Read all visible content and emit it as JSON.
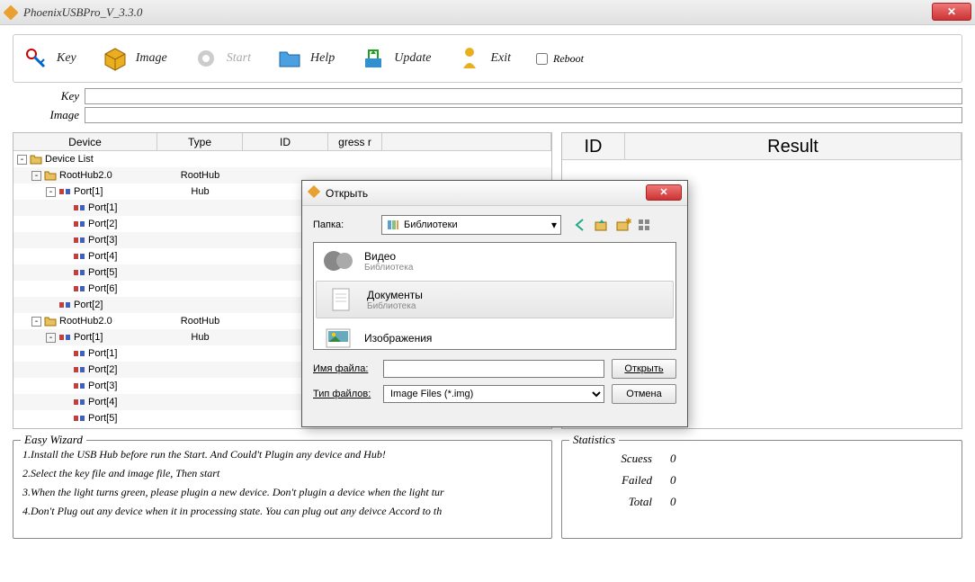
{
  "window": {
    "title": "PhoenixUSBPro_V_3.3.0"
  },
  "toolbar": {
    "key": "Key",
    "image": "Image",
    "start": "Start",
    "help": "Help",
    "update": "Update",
    "exit": "Exit",
    "reboot": "Reboot"
  },
  "fields": {
    "key_label": "Key",
    "key_value": "",
    "image_label": "Image",
    "image_value": ""
  },
  "devgrid": {
    "headers": {
      "device": "Device",
      "type": "Type",
      "id": "ID",
      "progress": "gress r"
    },
    "rows": [
      {
        "indent": 0,
        "exp": "-",
        "icon": "folder",
        "label": "Device List",
        "type": ""
      },
      {
        "indent": 1,
        "exp": "-",
        "icon": "folder",
        "label": "RootHub2.0",
        "type": "RootHub"
      },
      {
        "indent": 2,
        "exp": "-",
        "icon": "port",
        "label": "Port[1]",
        "type": "Hub"
      },
      {
        "indent": 3,
        "exp": "",
        "icon": "port",
        "label": "Port[1]",
        "type": ""
      },
      {
        "indent": 3,
        "exp": "",
        "icon": "port",
        "label": "Port[2]",
        "type": ""
      },
      {
        "indent": 3,
        "exp": "",
        "icon": "port",
        "label": "Port[3]",
        "type": ""
      },
      {
        "indent": 3,
        "exp": "",
        "icon": "port",
        "label": "Port[4]",
        "type": ""
      },
      {
        "indent": 3,
        "exp": "",
        "icon": "port",
        "label": "Port[5]",
        "type": ""
      },
      {
        "indent": 3,
        "exp": "",
        "icon": "port",
        "label": "Port[6]",
        "type": ""
      },
      {
        "indent": 2,
        "exp": "",
        "icon": "port",
        "label": "Port[2]",
        "type": ""
      },
      {
        "indent": 1,
        "exp": "-",
        "icon": "folder",
        "label": "RootHub2.0",
        "type": "RootHub"
      },
      {
        "indent": 2,
        "exp": "-",
        "icon": "port",
        "label": "Port[1]",
        "type": "Hub"
      },
      {
        "indent": 3,
        "exp": "",
        "icon": "port",
        "label": "Port[1]",
        "type": ""
      },
      {
        "indent": 3,
        "exp": "",
        "icon": "port",
        "label": "Port[2]",
        "type": ""
      },
      {
        "indent": 3,
        "exp": "",
        "icon": "port",
        "label": "Port[3]",
        "type": ""
      },
      {
        "indent": 3,
        "exp": "",
        "icon": "port",
        "label": "Port[4]",
        "type": ""
      },
      {
        "indent": 3,
        "exp": "",
        "icon": "port",
        "label": "Port[5]",
        "type": ""
      }
    ]
  },
  "result": {
    "id_header": "ID",
    "result_header": "Result"
  },
  "wizard": {
    "legend": "Easy Wizard",
    "lines": [
      "1.Install the USB Hub before run the Start. And Could't Plugin any device and Hub!",
      "2.Select the key file and image file, Then start",
      "3.When the light turns green, please plugin a new device. Don't plugin a device when the light tur",
      "4.Don't Plug out any device when it in processing state. You can plug out any deivce Accord to th"
    ]
  },
  "stats": {
    "legend": "Statistics",
    "rows": [
      {
        "label": "Scuess",
        "value": "0"
      },
      {
        "label": "Failed",
        "value": "0"
      },
      {
        "label": "Total",
        "value": "0"
      }
    ]
  },
  "dialog": {
    "title": "Открыть",
    "folder_label": "Папка:",
    "folder_value": "Библиотеки",
    "items": [
      {
        "name": "Видео",
        "sub": "Библиотека",
        "icon": "video",
        "selected": false
      },
      {
        "name": "Документы",
        "sub": "Библиотека",
        "icon": "doc",
        "selected": true
      },
      {
        "name": "Изображения",
        "sub": "",
        "icon": "image",
        "selected": false
      }
    ],
    "filename_label": "Имя файла:",
    "filename_value": "",
    "filetype_label": "Тип файлов:",
    "filetype_value": "Image Files (*.img)",
    "open_btn": "Открыть",
    "cancel_btn": "Отмена"
  }
}
